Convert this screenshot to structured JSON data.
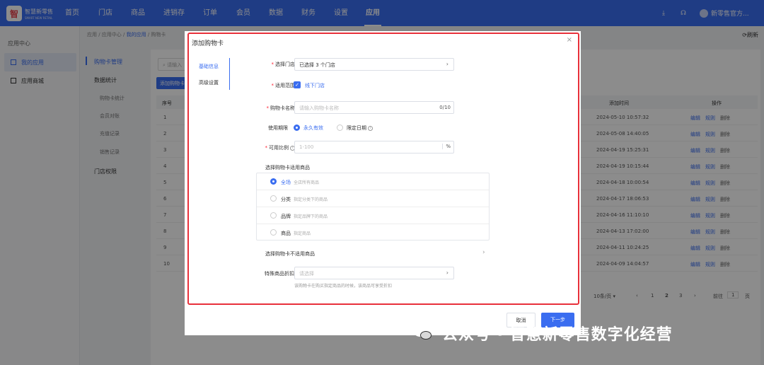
{
  "brand": {
    "name": "智慧新零售",
    "sub": "SMART NEW RETAIL"
  },
  "topnav": {
    "items": [
      "首页",
      "门店",
      "商品",
      "进销存",
      "订单",
      "会员",
      "数据",
      "财务",
      "设置",
      "应用"
    ],
    "active_index": 9,
    "user": "新零售官方..."
  },
  "sidebar": {
    "title": "应用中心",
    "items": [
      {
        "label": "我的应用",
        "icon": "grid-icon",
        "active": true
      },
      {
        "label": "应用商城",
        "icon": "grid-icon",
        "active": false
      }
    ]
  },
  "submenu": {
    "items": [
      {
        "label": "购物卡管理",
        "active": true
      },
      {
        "label": "数据统计",
        "group": true
      },
      {
        "label": "购物卡统计"
      },
      {
        "label": "会员对账"
      },
      {
        "label": "充值记录"
      },
      {
        "label": "销售记录"
      },
      {
        "label": "门店权限"
      }
    ]
  },
  "breadcrumb": {
    "path": "应用 / 应用中心 / ",
    "current": "我的应用",
    "tail": " / 购物卡"
  },
  "refresh_label": "刷新",
  "background": {
    "search_placeholder": "请输入",
    "add_button": "添加购物卡",
    "headers": {
      "index": "序号",
      "time": "添加时间",
      "ops": "操作"
    },
    "rows": [
      {
        "index": "1",
        "time": "2024-05-10 10:57:32"
      },
      {
        "index": "2",
        "time": "2024-05-08 14:40:05"
      },
      {
        "index": "3",
        "time": "2024-04-19 15:25:31"
      },
      {
        "index": "4",
        "time": "2024-04-19 10:15:44"
      },
      {
        "index": "5",
        "time": "2024-04-18 10:00:54"
      },
      {
        "index": "6",
        "time": "2024-04-17 18:06:53"
      },
      {
        "index": "7",
        "time": "2024-04-16 11:10:10"
      },
      {
        "index": "8",
        "time": "2024-04-13 17:02:00"
      },
      {
        "index": "9",
        "time": "2024-04-11 10:24:25"
      },
      {
        "index": "10",
        "time": "2024-04-09 14:04:57"
      }
    ],
    "actions": {
      "edit": "编辑",
      "rule": "规则",
      "delete": "删除"
    },
    "pager": {
      "page_size": "10条/页",
      "pages": [
        "1",
        "2",
        "3"
      ],
      "goto_label": "前往",
      "goto_value": "1",
      "page_unit": "页"
    }
  },
  "dialog": {
    "title": "添加购物卡",
    "tabs": [
      "基础信息",
      "高级设置"
    ],
    "store": {
      "label": "选择门店",
      "value": "已选择 3 个门店"
    },
    "scope": {
      "label": "适用范围",
      "value": "线下门店"
    },
    "name": {
      "label": "购物卡名称",
      "placeholder": "请输入购物卡名称",
      "counter": "0/10"
    },
    "validity": {
      "label": "使用期限",
      "options": [
        "永久有效",
        "限定日期"
      ],
      "selected": 0
    },
    "ratio": {
      "label": "可用比例",
      "placeholder": "1-100",
      "suffix": "%"
    },
    "goods_label": "选择购物卡适用商品",
    "goods_options": [
      {
        "name": "全场",
        "desc": "全店所有商品",
        "selected": true
      },
      {
        "name": "分类",
        "desc": "指定分类下的商品",
        "selected": false
      },
      {
        "name": "品牌",
        "desc": "指定品牌下的商品",
        "selected": false
      },
      {
        "name": "商品",
        "desc": "指定商品",
        "selected": false
      }
    ],
    "excluded_label": "选择购物卡不适用商品",
    "special": {
      "label": "特殊商品折扣",
      "placeholder": "请选择",
      "hint": "该购物卡在购买指定商品的时候，该商品可享受折扣"
    },
    "cancel_label": "取消",
    "next_label": "下一步"
  },
  "watermark": {
    "text": "公众号 · 智慧新零售数字化经营"
  },
  "colors": {
    "primary": "#3a6df0",
    "highlight_border": "#e8303a"
  }
}
